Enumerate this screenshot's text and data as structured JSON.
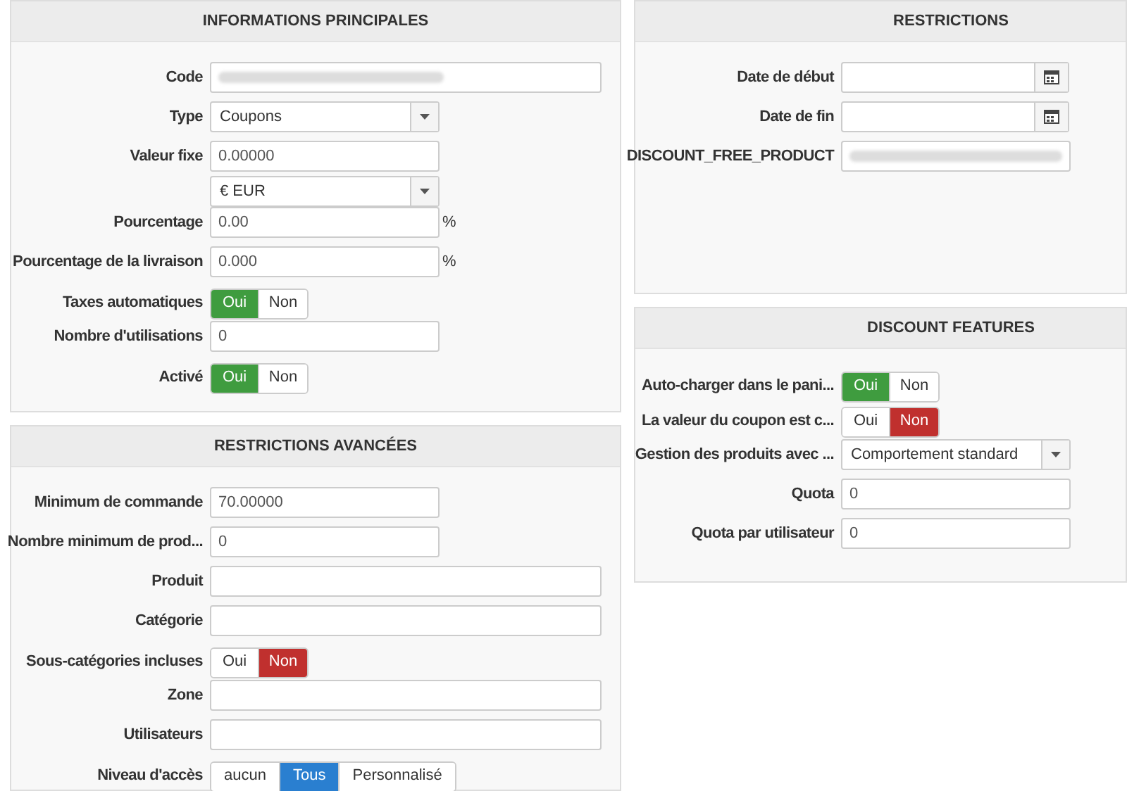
{
  "columns": [
    {
      "panels": [
        {
          "title": "INFORMATIONS PRINCIPALES",
          "fields": [
            {
              "kind": "lookup",
              "label": "Code",
              "blurred": true
            },
            {
              "kind": "select",
              "label": "Type",
              "value": "Coupons"
            },
            {
              "kind": "currency",
              "label": "Valeur fixe",
              "value": "0.00000",
              "currency": "€ EUR"
            },
            {
              "kind": "suffix",
              "label": "Pourcentage",
              "value": "0.00",
              "suffix": "%"
            },
            {
              "kind": "suffix",
              "label": "Pourcentage de la livraison",
              "value": "0.000",
              "suffix": "%"
            },
            {
              "kind": "toggle",
              "label": "Taxes automatiques",
              "options": [
                {
                  "label": "Oui",
                  "selected": true
                },
                {
                  "label": "Non",
                  "selected": false
                }
              ]
            },
            {
              "kind": "input",
              "label": "Nombre d'utilisations",
              "value": "0"
            },
            {
              "kind": "toggle",
              "label": "Activé",
              "options": [
                {
                  "label": "Oui",
                  "selected": true
                },
                {
                  "label": "Non",
                  "selected": false
                }
              ]
            }
          ]
        },
        {
          "title": "RESTRICTIONS AVANCÉES",
          "fields": [
            {
              "kind": "input",
              "label": "Minimum de commande",
              "value": "70.00000"
            },
            {
              "kind": "input",
              "label": "Nombre minimum de prod...",
              "value": "0"
            },
            {
              "kind": "lookup",
              "label": "Produit"
            },
            {
              "kind": "lookup",
              "label": "Catégorie"
            },
            {
              "kind": "toggle",
              "label": "Sous-catégories incluses",
              "options": [
                {
                  "label": "Oui",
                  "selected": false
                },
                {
                  "label": "Non",
                  "selected": true
                }
              ]
            },
            {
              "kind": "lookup",
              "label": "Zone"
            },
            {
              "kind": "lookup",
              "label": "Utilisateurs"
            },
            {
              "kind": "segmented",
              "label": "Niveau d'accès",
              "options": [
                {
                  "label": "aucun",
                  "selected": false
                },
                {
                  "label": "Tous",
                  "selected": true
                },
                {
                  "label": "Personnalisé",
                  "selected": false
                }
              ]
            }
          ]
        }
      ]
    },
    {
      "panels": [
        {
          "title": "RESTRICTIONS",
          "fields": [
            {
              "kind": "date",
              "label": "Date de début"
            },
            {
              "kind": "date",
              "label": "Date de fin"
            },
            {
              "kind": "lookup",
              "label": "DISCOUNT_FREE_PRODUCT",
              "blurred": true
            }
          ]
        },
        {
          "title": "DISCOUNT FEATURES",
          "fields": [
            {
              "kind": "toggle",
              "label": "Auto-charger dans le pani...",
              "options": [
                {
                  "label": "Oui",
                  "selected": true
                },
                {
                  "label": "Non",
                  "selected": false
                }
              ]
            },
            {
              "kind": "toggle",
              "label": "La valeur du coupon est c...",
              "options": [
                {
                  "label": "Oui",
                  "selected": false
                },
                {
                  "label": "Non",
                  "selected": true
                }
              ]
            },
            {
              "kind": "select",
              "label": "Gestion des produits avec ...",
              "value": "Comportement standard"
            },
            {
              "kind": "input",
              "label": "Quota",
              "value": "0"
            },
            {
              "kind": "input",
              "label": "Quota par utilisateur",
              "value": "0"
            }
          ]
        }
      ]
    }
  ]
}
